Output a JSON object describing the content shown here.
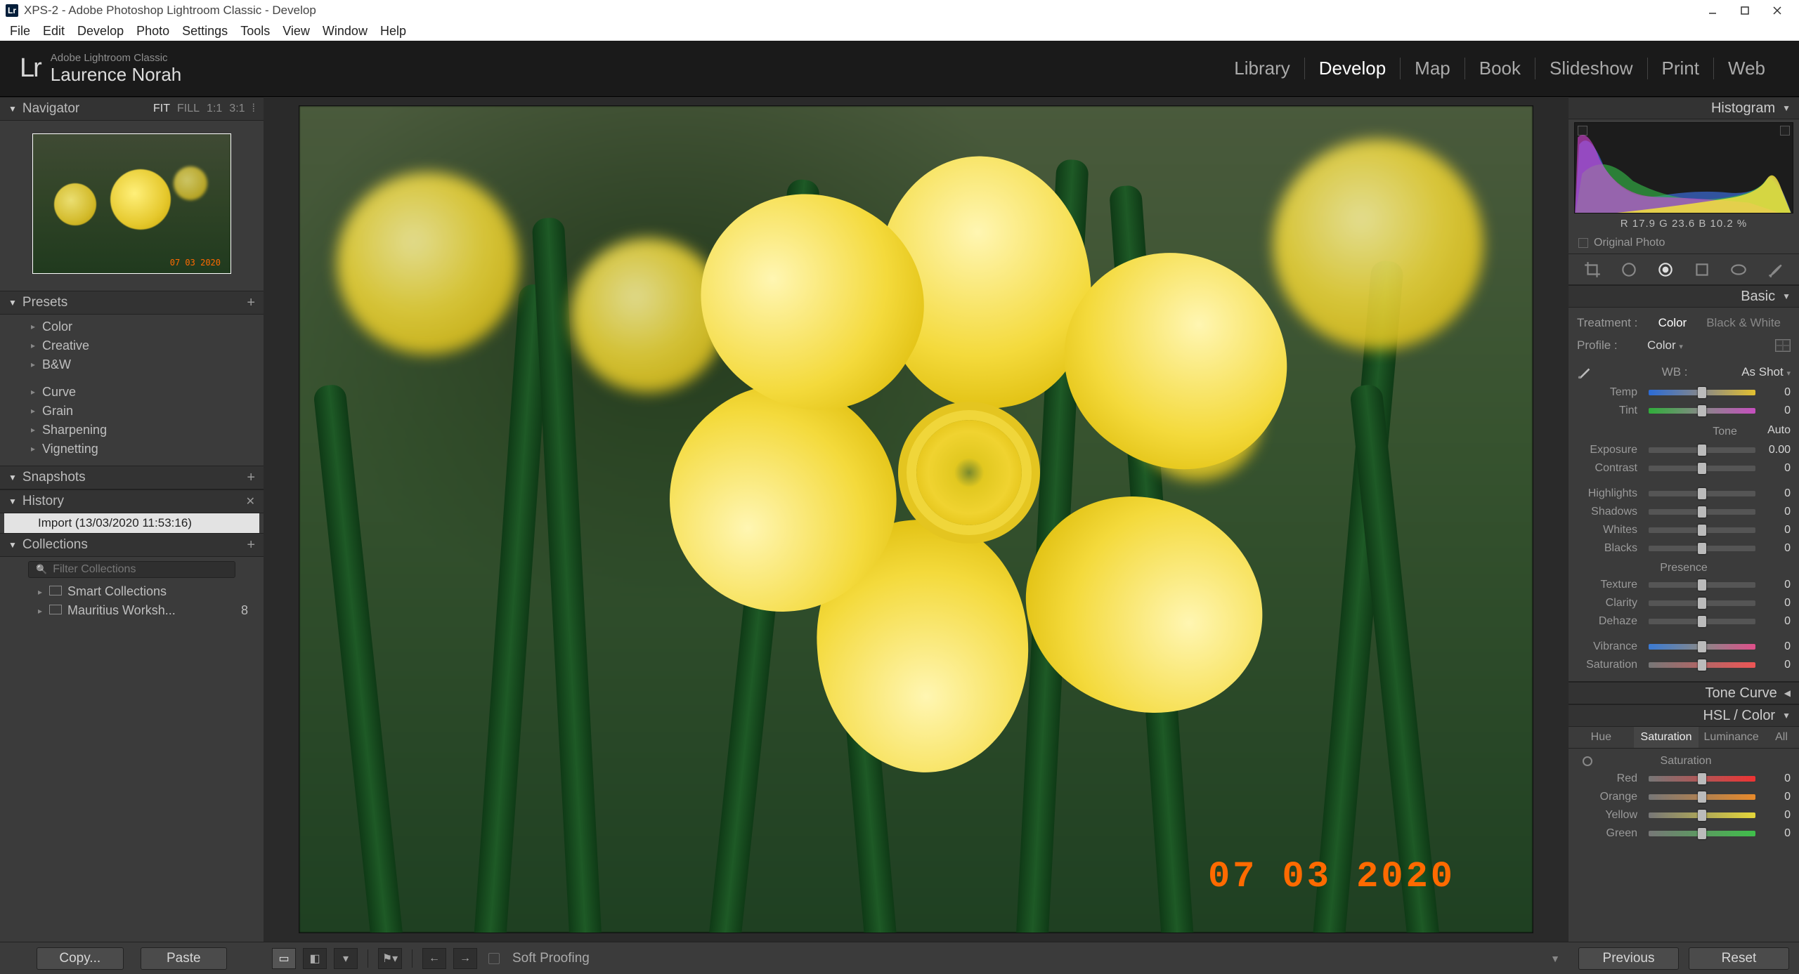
{
  "window": {
    "title": "XPS-2 - Adobe Photoshop Lightroom Classic - Develop"
  },
  "menu": [
    "File",
    "Edit",
    "Develop",
    "Photo",
    "Settings",
    "Tools",
    "View",
    "Window",
    "Help"
  ],
  "brand": {
    "small": "Adobe Lightroom Classic",
    "user": "Laurence Norah",
    "logo": "Lr"
  },
  "modules": [
    "Library",
    "Develop",
    "Map",
    "Book",
    "Slideshow",
    "Print",
    "Web"
  ],
  "modules_active": "Develop",
  "nav": {
    "title": "Navigator",
    "zoom": {
      "fit": "FIT",
      "fill": "FILL",
      "one": "1:1",
      "ratio": "3:1"
    },
    "thumb_stamp": "07 03 2020"
  },
  "presets": {
    "title": "Presets",
    "items": [
      "Color",
      "Creative",
      "B&W",
      "Curve",
      "Grain",
      "Sharpening",
      "Vignetting"
    ]
  },
  "snapshots": {
    "title": "Snapshots"
  },
  "history": {
    "title": "History",
    "entry": "Import (13/03/2020 11:53:16)"
  },
  "collections": {
    "title": "Collections",
    "filter_ph": "Filter Collections",
    "items": [
      {
        "label": "Smart Collections",
        "count": ""
      },
      {
        "label": "Mauritius Worksh...",
        "count": "8"
      }
    ]
  },
  "left_buttons": {
    "copy": "Copy...",
    "paste": "Paste"
  },
  "toolbar": {
    "soft": "Soft Proofing"
  },
  "image": {
    "stamp": "07 03 2020"
  },
  "histogram": {
    "title": "Histogram",
    "readout": "R 17.9  G 23.6  B 10.2 %",
    "orig": "Original Photo"
  },
  "basic": {
    "title": "Basic",
    "treat_l": "Treatment :",
    "treat_color": "Color",
    "treat_bw": "Black & White",
    "profile_l": "Profile :",
    "profile_v": "Color",
    "wb_l": "WB :",
    "wb_v": "As Shot",
    "temp": {
      "l": "Temp",
      "v": "0"
    },
    "tint": {
      "l": "Tint",
      "v": "0"
    },
    "tone_title": "Tone",
    "auto": "Auto",
    "exposure": {
      "l": "Exposure",
      "v": "0.00"
    },
    "contrast": {
      "l": "Contrast",
      "v": "0"
    },
    "highlights": {
      "l": "Highlights",
      "v": "0"
    },
    "shadows": {
      "l": "Shadows",
      "v": "0"
    },
    "whites": {
      "l": "Whites",
      "v": "0"
    },
    "blacks": {
      "l": "Blacks",
      "v": "0"
    },
    "presence_title": "Presence",
    "texture": {
      "l": "Texture",
      "v": "0"
    },
    "clarity": {
      "l": "Clarity",
      "v": "0"
    },
    "dehaze": {
      "l": "Dehaze",
      "v": "0"
    },
    "vibrance": {
      "l": "Vibrance",
      "v": "0"
    },
    "saturation": {
      "l": "Saturation",
      "v": "0"
    }
  },
  "tonecurve": {
    "title": "Tone Curve"
  },
  "hsl": {
    "title": "HSL / Color",
    "tabs": {
      "hue": "Hue",
      "sat": "Saturation",
      "lum": "Luminance",
      "all": "All"
    },
    "sat_title": "Saturation",
    "red": {
      "l": "Red",
      "v": "0"
    },
    "orange": {
      "l": "Orange",
      "v": "0"
    },
    "yellow": {
      "l": "Yellow",
      "v": "0"
    },
    "green": {
      "l": "Green",
      "v": "0"
    }
  },
  "right_buttons": {
    "prev": "Previous",
    "reset": "Reset"
  }
}
